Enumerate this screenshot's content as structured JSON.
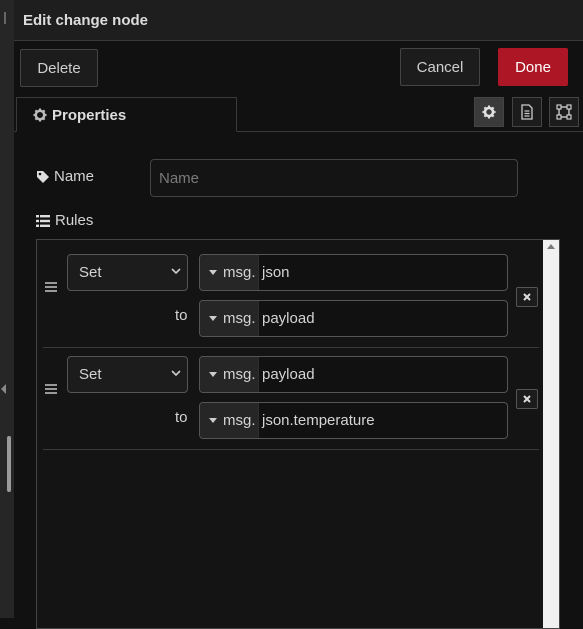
{
  "dialog": {
    "title": "Edit change node",
    "delete_label": "Delete",
    "cancel_label": "Cancel",
    "done_label": "Done",
    "accent_color": "#ad1625"
  },
  "tabs": [
    {
      "label": "Properties",
      "icon": "gear-icon"
    }
  ],
  "tab_tools": [
    "settings-icon",
    "description-icon",
    "appearance-icon"
  ],
  "form": {
    "name_label": "Name",
    "name_placeholder": "Name",
    "name_value": "",
    "rules_label": "Rules"
  },
  "rules": [
    {
      "action": "Set",
      "target_type": "msg.",
      "target": "json",
      "to_label": "to",
      "value_type": "msg.",
      "value": "payload"
    },
    {
      "action": "Set",
      "target_type": "msg.",
      "target": "payload",
      "to_label": "to",
      "value_type": "msg.",
      "value": "json.temperature"
    }
  ]
}
